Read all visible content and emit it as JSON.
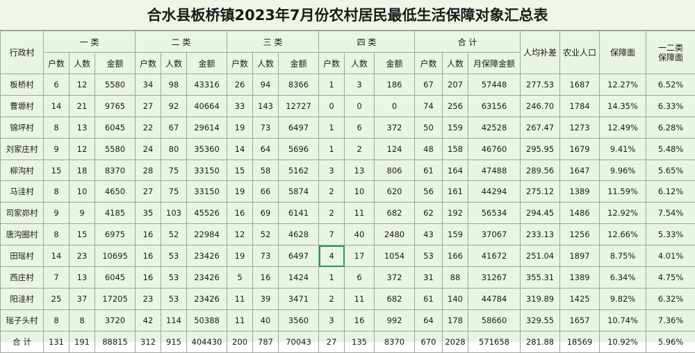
{
  "title": "合水县板桥镇2023年7月份农村居民最低生活保障对象汇总表",
  "headers": {
    "village": "行政村",
    "groups": [
      "一 类",
      "二 类",
      "三 类",
      "四 类",
      "合 计"
    ],
    "group_sub": [
      "户数",
      "人数",
      "金额"
    ],
    "total_sub": [
      "户数",
      "人数",
      "月保障金额"
    ],
    "avg": "人均补差",
    "agri": "农业人口",
    "cover": "保障面",
    "cover12": "一二类\n保障面"
  },
  "rows": [
    [
      "板桥村",
      "6",
      "12",
      "5580",
      "34",
      "98",
      "43316",
      "26",
      "94",
      "8366",
      "1",
      "3",
      "186",
      "67",
      "207",
      "57448",
      "277.53",
      "1687",
      "12.27%",
      "6.52%"
    ],
    [
      "曹塬村",
      "14",
      "21",
      "9765",
      "27",
      "92",
      "40664",
      "33",
      "143",
      "12727",
      "0",
      "0",
      "0",
      "74",
      "256",
      "63156",
      "246.70",
      "1784",
      "14.35%",
      "6.33%"
    ],
    [
      "锦坪村",
      "8",
      "13",
      "6045",
      "22",
      "67",
      "29614",
      "19",
      "73",
      "6497",
      "1",
      "6",
      "372",
      "50",
      "159",
      "42528",
      "267.47",
      "1273",
      "12.49%",
      "6.28%"
    ],
    [
      "刘家庄村",
      "9",
      "12",
      "5580",
      "24",
      "80",
      "35360",
      "14",
      "64",
      "5696",
      "1",
      "2",
      "124",
      "48",
      "158",
      "46760",
      "295.95",
      "1679",
      "9.41%",
      "5.48%"
    ],
    [
      "柳沟村",
      "15",
      "18",
      "8370",
      "28",
      "75",
      "33150",
      "15",
      "58",
      "5162",
      "3",
      "13",
      "806",
      "61",
      "164",
      "47488",
      "289.56",
      "1647",
      "9.96%",
      "5.65%"
    ],
    [
      "马洼村",
      "8",
      "10",
      "4650",
      "27",
      "75",
      "33150",
      "19",
      "66",
      "5874",
      "2",
      "10",
      "620",
      "56",
      "161",
      "44294",
      "275.12",
      "1389",
      "11.59%",
      "6.12%"
    ],
    [
      "司家峁村",
      "9",
      "9",
      "4185",
      "35",
      "103",
      "45526",
      "16",
      "69",
      "6141",
      "2",
      "11",
      "682",
      "62",
      "192",
      "56534",
      "294.45",
      "1486",
      "12.92%",
      "7.54%"
    ],
    [
      "唐沟圈村",
      "8",
      "15",
      "6975",
      "16",
      "52",
      "22984",
      "12",
      "52",
      "4628",
      "7",
      "40",
      "2480",
      "43",
      "159",
      "37067",
      "233.13",
      "1256",
      "12.66%",
      "5.33%"
    ],
    [
      "田瑶村",
      "14",
      "23",
      "10695",
      "16",
      "53",
      "23426",
      "19",
      "73",
      "6497",
      "4",
      "17",
      "1054",
      "53",
      "166",
      "41672",
      "251.04",
      "1897",
      "8.75%",
      "4.01%"
    ],
    [
      "西庄村",
      "7",
      "13",
      "6045",
      "16",
      "53",
      "23426",
      "5",
      "16",
      "1424",
      "1",
      "6",
      "372",
      "31",
      "88",
      "31267",
      "355.31",
      "1389",
      "6.34%",
      "4.75%"
    ],
    [
      "阳洼村",
      "25",
      "37",
      "17205",
      "23",
      "53",
      "23426",
      "11",
      "39",
      "3471",
      "2",
      "11",
      "682",
      "61",
      "140",
      "44784",
      "319.89",
      "1425",
      "9.82%",
      "6.32%"
    ],
    [
      "瑶子头村",
      "8",
      "8",
      "3720",
      "42",
      "114",
      "50388",
      "11",
      "40",
      "3560",
      "3",
      "16",
      "992",
      "64",
      "178",
      "58660",
      "329.55",
      "1657",
      "10.74%",
      "7.36%"
    ],
    [
      "合 计",
      "131",
      "191",
      "88815",
      "312",
      "915",
      "404430",
      "200",
      "787",
      "70043",
      "27",
      "135",
      "8370",
      "670",
      "2028",
      "571658",
      "281.88",
      "18569",
      "10.92%",
      "5.96%"
    ]
  ]
}
